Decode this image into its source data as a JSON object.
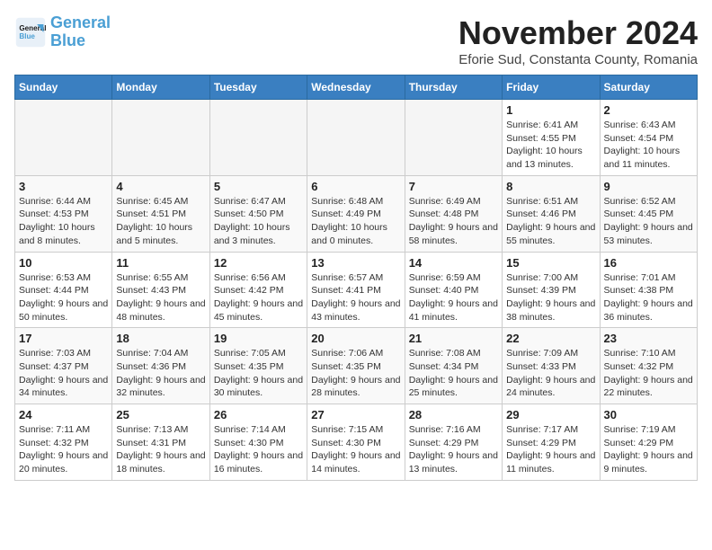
{
  "logo": {
    "line1": "General",
    "line2": "Blue"
  },
  "title": "November 2024",
  "location": "Eforie Sud, Constanta County, Romania",
  "days_of_week": [
    "Sunday",
    "Monday",
    "Tuesday",
    "Wednesday",
    "Thursday",
    "Friday",
    "Saturday"
  ],
  "weeks": [
    [
      {
        "day": "",
        "info": ""
      },
      {
        "day": "",
        "info": ""
      },
      {
        "day": "",
        "info": ""
      },
      {
        "day": "",
        "info": ""
      },
      {
        "day": "",
        "info": ""
      },
      {
        "day": "1",
        "info": "Sunrise: 6:41 AM\nSunset: 4:55 PM\nDaylight: 10 hours and 13 minutes."
      },
      {
        "day": "2",
        "info": "Sunrise: 6:43 AM\nSunset: 4:54 PM\nDaylight: 10 hours and 11 minutes."
      }
    ],
    [
      {
        "day": "3",
        "info": "Sunrise: 6:44 AM\nSunset: 4:53 PM\nDaylight: 10 hours and 8 minutes."
      },
      {
        "day": "4",
        "info": "Sunrise: 6:45 AM\nSunset: 4:51 PM\nDaylight: 10 hours and 5 minutes."
      },
      {
        "day": "5",
        "info": "Sunrise: 6:47 AM\nSunset: 4:50 PM\nDaylight: 10 hours and 3 minutes."
      },
      {
        "day": "6",
        "info": "Sunrise: 6:48 AM\nSunset: 4:49 PM\nDaylight: 10 hours and 0 minutes."
      },
      {
        "day": "7",
        "info": "Sunrise: 6:49 AM\nSunset: 4:48 PM\nDaylight: 9 hours and 58 minutes."
      },
      {
        "day": "8",
        "info": "Sunrise: 6:51 AM\nSunset: 4:46 PM\nDaylight: 9 hours and 55 minutes."
      },
      {
        "day": "9",
        "info": "Sunrise: 6:52 AM\nSunset: 4:45 PM\nDaylight: 9 hours and 53 minutes."
      }
    ],
    [
      {
        "day": "10",
        "info": "Sunrise: 6:53 AM\nSunset: 4:44 PM\nDaylight: 9 hours and 50 minutes."
      },
      {
        "day": "11",
        "info": "Sunrise: 6:55 AM\nSunset: 4:43 PM\nDaylight: 9 hours and 48 minutes."
      },
      {
        "day": "12",
        "info": "Sunrise: 6:56 AM\nSunset: 4:42 PM\nDaylight: 9 hours and 45 minutes."
      },
      {
        "day": "13",
        "info": "Sunrise: 6:57 AM\nSunset: 4:41 PM\nDaylight: 9 hours and 43 minutes."
      },
      {
        "day": "14",
        "info": "Sunrise: 6:59 AM\nSunset: 4:40 PM\nDaylight: 9 hours and 41 minutes."
      },
      {
        "day": "15",
        "info": "Sunrise: 7:00 AM\nSunset: 4:39 PM\nDaylight: 9 hours and 38 minutes."
      },
      {
        "day": "16",
        "info": "Sunrise: 7:01 AM\nSunset: 4:38 PM\nDaylight: 9 hours and 36 minutes."
      }
    ],
    [
      {
        "day": "17",
        "info": "Sunrise: 7:03 AM\nSunset: 4:37 PM\nDaylight: 9 hours and 34 minutes."
      },
      {
        "day": "18",
        "info": "Sunrise: 7:04 AM\nSunset: 4:36 PM\nDaylight: 9 hours and 32 minutes."
      },
      {
        "day": "19",
        "info": "Sunrise: 7:05 AM\nSunset: 4:35 PM\nDaylight: 9 hours and 30 minutes."
      },
      {
        "day": "20",
        "info": "Sunrise: 7:06 AM\nSunset: 4:35 PM\nDaylight: 9 hours and 28 minutes."
      },
      {
        "day": "21",
        "info": "Sunrise: 7:08 AM\nSunset: 4:34 PM\nDaylight: 9 hours and 25 minutes."
      },
      {
        "day": "22",
        "info": "Sunrise: 7:09 AM\nSunset: 4:33 PM\nDaylight: 9 hours and 24 minutes."
      },
      {
        "day": "23",
        "info": "Sunrise: 7:10 AM\nSunset: 4:32 PM\nDaylight: 9 hours and 22 minutes."
      }
    ],
    [
      {
        "day": "24",
        "info": "Sunrise: 7:11 AM\nSunset: 4:32 PM\nDaylight: 9 hours and 20 minutes."
      },
      {
        "day": "25",
        "info": "Sunrise: 7:13 AM\nSunset: 4:31 PM\nDaylight: 9 hours and 18 minutes."
      },
      {
        "day": "26",
        "info": "Sunrise: 7:14 AM\nSunset: 4:30 PM\nDaylight: 9 hours and 16 minutes."
      },
      {
        "day": "27",
        "info": "Sunrise: 7:15 AM\nSunset: 4:30 PM\nDaylight: 9 hours and 14 minutes."
      },
      {
        "day": "28",
        "info": "Sunrise: 7:16 AM\nSunset: 4:29 PM\nDaylight: 9 hours and 13 minutes."
      },
      {
        "day": "29",
        "info": "Sunrise: 7:17 AM\nSunset: 4:29 PM\nDaylight: 9 hours and 11 minutes."
      },
      {
        "day": "30",
        "info": "Sunrise: 7:19 AM\nSunset: 4:29 PM\nDaylight: 9 hours and 9 minutes."
      }
    ]
  ]
}
